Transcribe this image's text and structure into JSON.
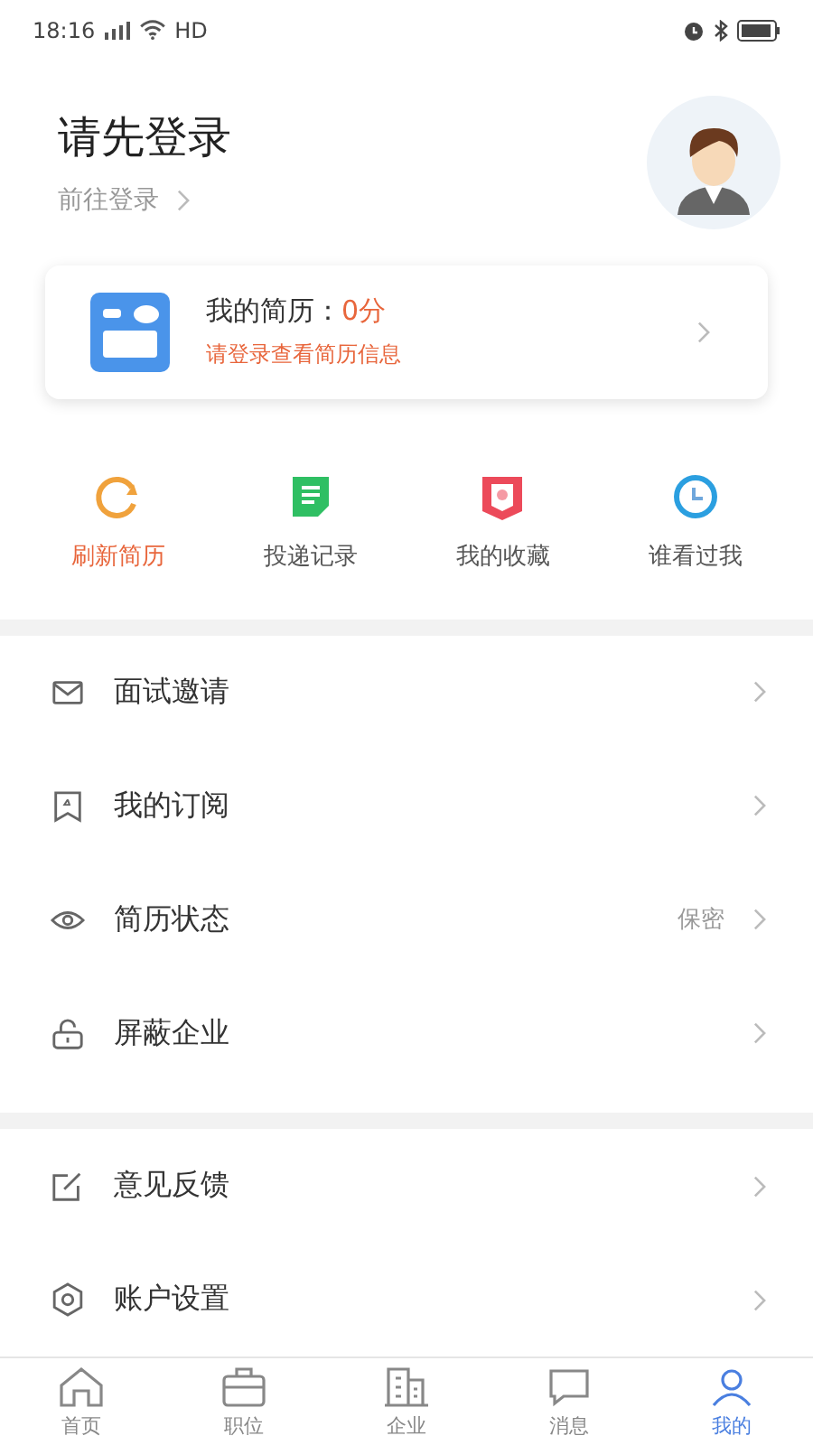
{
  "status_bar": {
    "time": "18:16",
    "network": "HD"
  },
  "header": {
    "title": "请先登录",
    "login_link": "前往登录"
  },
  "resume_card": {
    "label": "我的简历：",
    "score": "0分",
    "hint": "请登录查看简历信息"
  },
  "quick_actions": [
    {
      "label": "刷新简历",
      "selected": true
    },
    {
      "label": "投递记录",
      "selected": false
    },
    {
      "label": "我的收藏",
      "selected": false
    },
    {
      "label": "谁看过我",
      "selected": false
    }
  ],
  "menu_groups": [
    [
      {
        "label": "面试邀请"
      },
      {
        "label": "我的订阅"
      },
      {
        "label": "简历状态",
        "value": "保密"
      },
      {
        "label": "屏蔽企业"
      }
    ],
    [
      {
        "label": "意见反馈"
      },
      {
        "label": "账户设置"
      }
    ]
  ],
  "tab_bar": [
    {
      "label": "首页",
      "selected": false
    },
    {
      "label": "职位",
      "selected": false
    },
    {
      "label": "企业",
      "selected": false
    },
    {
      "label": "消息",
      "selected": false
    },
    {
      "label": "我的",
      "selected": true
    }
  ]
}
